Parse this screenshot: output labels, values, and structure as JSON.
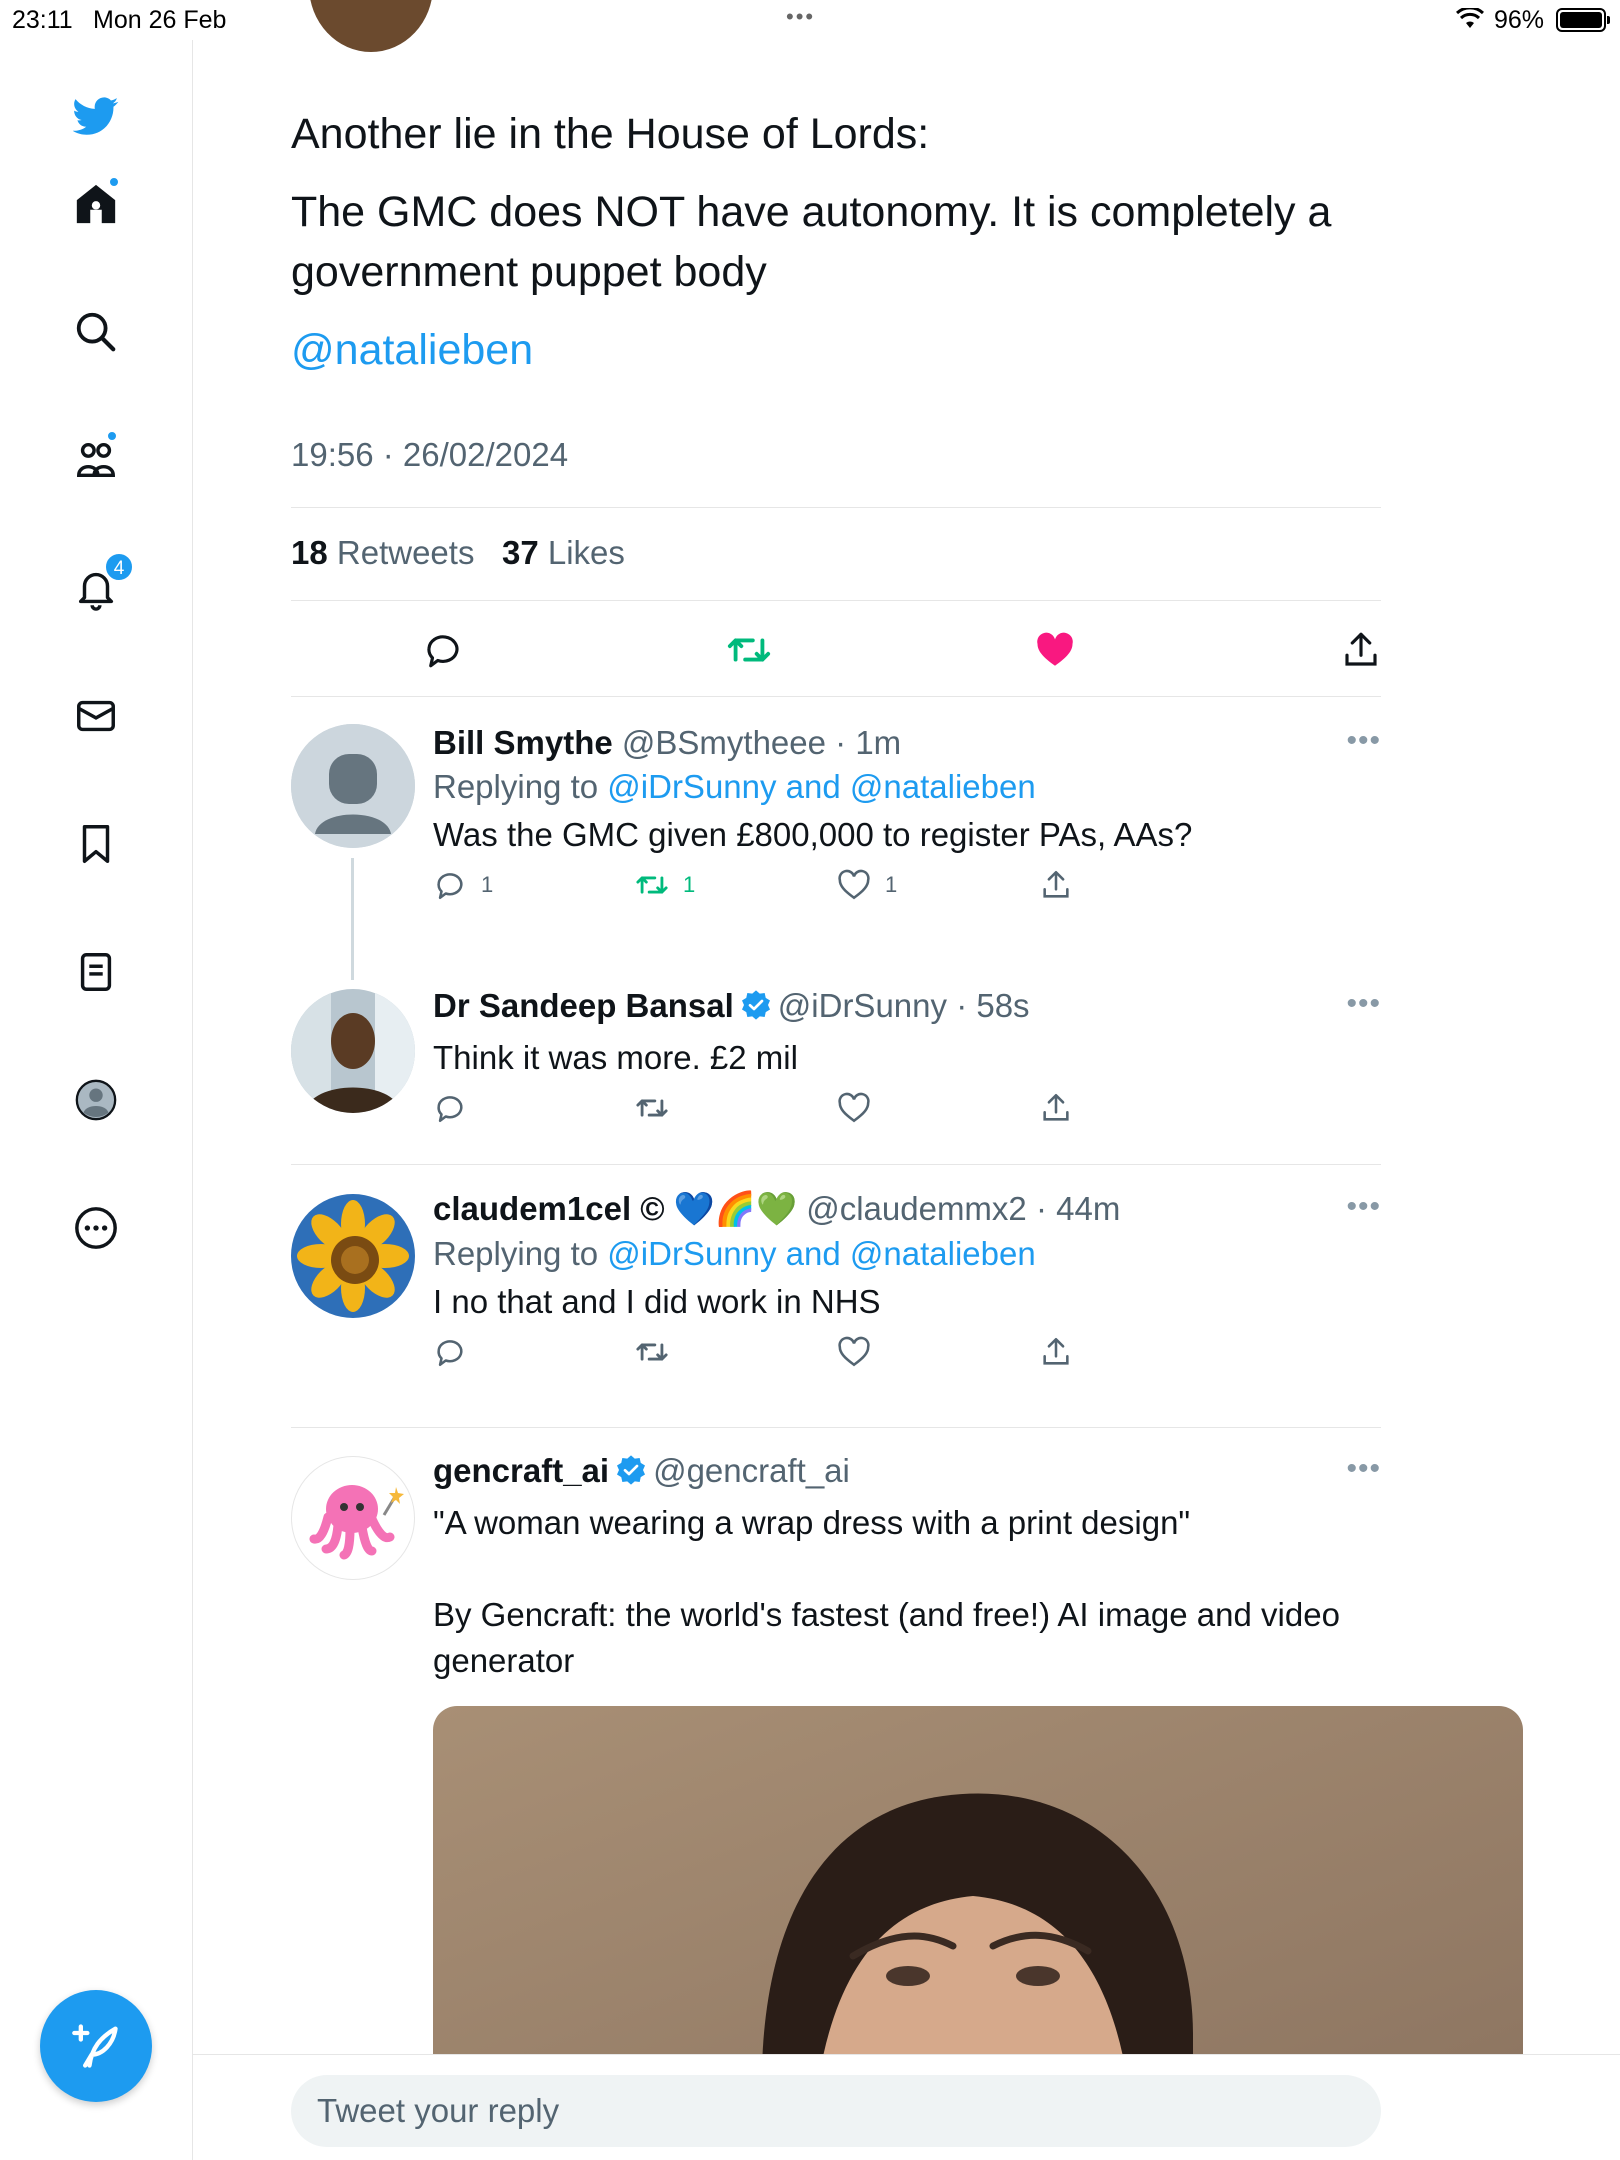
{
  "status_bar": {
    "time": "23:11",
    "date": "Mon 26 Feb",
    "battery": "96%"
  },
  "sidebar": {
    "notifications_count": "4",
    "items": [
      "home",
      "search",
      "communities",
      "notifications",
      "messages",
      "bookmarks",
      "lists",
      "profile",
      "more"
    ]
  },
  "tweet": {
    "line1": "Another lie in the House of Lords:",
    "line2": "The GMC does NOT have autonomy. It is completely a government puppet body",
    "mention": "@natalieben",
    "timestamp": "19:56 · 26/02/2024",
    "retweets_count": "18",
    "retweets_label": "Retweets",
    "likes_count": "37",
    "likes_label": "Likes"
  },
  "replies": [
    {
      "name": "Bill Smythe",
      "handle": "@BSmytheee",
      "time": "· 1m",
      "replying_prefix": "Replying to",
      "replying_to": "@iDrSunny and @natalieben",
      "text": "Was the GMC given £800,000 to register PAs, AAs?",
      "reply_count": "1",
      "retweet_count": "1",
      "like_count": "1"
    },
    {
      "name": "Dr Sandeep Bansal",
      "handle": "@iDrSunny",
      "time": "· 58s",
      "text": "Think it was more. £2 mil"
    },
    {
      "name": "claudem1cel © 💙🌈💚",
      "handle": "@claudemmx2",
      "time": "· 44m",
      "replying_prefix": "Replying to",
      "replying_to": "@iDrSunny and @natalieben",
      "text": "I no that and I did work in NHS"
    },
    {
      "name": "gencraft_ai",
      "handle": "@gencraft_ai",
      "text1": "\"A woman wearing a wrap dress with a print design\"",
      "text2": "By Gencraft: the world's fastest (and free!) AI image and video generator"
    }
  ],
  "reply_bar": {
    "placeholder": "Tweet your reply"
  },
  "colors": {
    "accent": "#1d9bf0",
    "retweet": "#00ba7c",
    "like": "#f91880",
    "text": "#0f1419",
    "muted": "#536471"
  }
}
